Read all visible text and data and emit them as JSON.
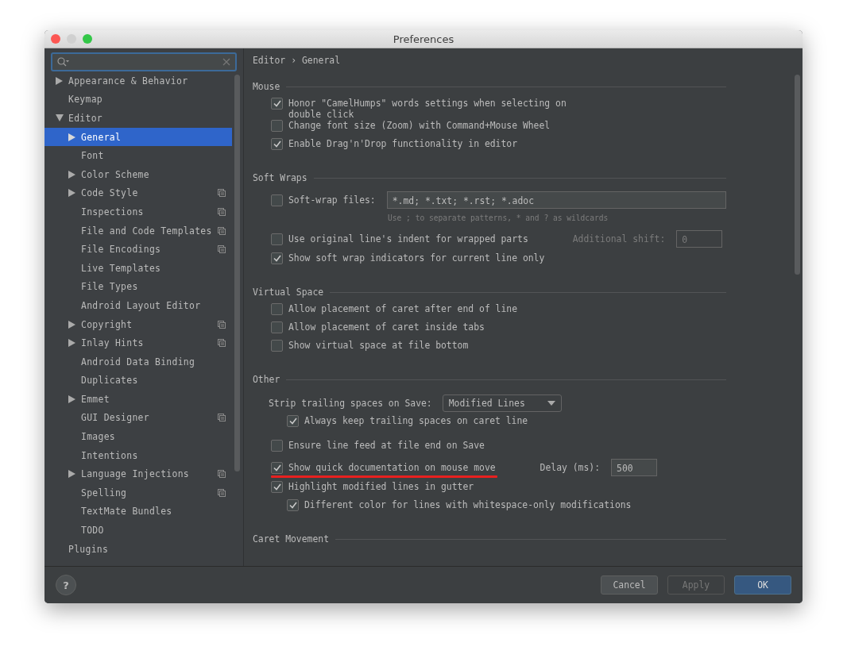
{
  "window": {
    "title": "Preferences"
  },
  "sidebar": {
    "items": [
      {
        "label": "Appearance & Behavior",
        "expanded": false,
        "selected": false,
        "project_scope": false
      },
      {
        "label": "Keymap",
        "selected": false,
        "project_scope": false
      },
      {
        "label": "Editor",
        "expanded": true,
        "selected": false,
        "project_scope": false,
        "children": [
          {
            "label": "General",
            "expanded": false,
            "selected": true,
            "project_scope": false
          },
          {
            "label": "Font",
            "selected": false,
            "project_scope": false
          },
          {
            "label": "Color Scheme",
            "expanded": false,
            "selected": false,
            "project_scope": false
          },
          {
            "label": "Code Style",
            "expanded": false,
            "selected": false,
            "project_scope": true
          },
          {
            "label": "Inspections",
            "selected": false,
            "project_scope": true
          },
          {
            "label": "File and Code Templates",
            "selected": false,
            "project_scope": true
          },
          {
            "label": "File Encodings",
            "selected": false,
            "project_scope": true
          },
          {
            "label": "Live Templates",
            "selected": false,
            "project_scope": false
          },
          {
            "label": "File Types",
            "selected": false,
            "project_scope": false
          },
          {
            "label": "Android Layout Editor",
            "selected": false,
            "project_scope": false
          },
          {
            "label": "Copyright",
            "expanded": false,
            "selected": false,
            "project_scope": true
          },
          {
            "label": "Inlay Hints",
            "expanded": false,
            "selected": false,
            "project_scope": true
          },
          {
            "label": "Android Data Binding",
            "selected": false,
            "project_scope": false
          },
          {
            "label": "Duplicates",
            "selected": false,
            "project_scope": false
          },
          {
            "label": "Emmet",
            "expanded": false,
            "selected": false,
            "project_scope": false
          },
          {
            "label": "GUI Designer",
            "selected": false,
            "project_scope": true
          },
          {
            "label": "Images",
            "selected": false,
            "project_scope": false
          },
          {
            "label": "Intentions",
            "selected": false,
            "project_scope": false
          },
          {
            "label": "Language Injections",
            "expanded": false,
            "selected": false,
            "project_scope": true
          },
          {
            "label": "Spelling",
            "selected": false,
            "project_scope": true
          },
          {
            "label": "TextMate Bundles",
            "selected": false,
            "project_scope": false
          },
          {
            "label": "TODO",
            "selected": false,
            "project_scope": false
          }
        ]
      },
      {
        "label": "Plugins",
        "selected": false,
        "project_scope": false
      }
    ]
  },
  "breadcrumb": [
    "Editor",
    "›",
    "General"
  ],
  "sections": [
    {
      "title": "Mouse",
      "items": [
        {
          "kind": "checkbox",
          "label": "Honor \"CamelHumps\" words settings when selecting on double click",
          "checked": true
        },
        {
          "kind": "checkbox",
          "label": "Change font size (Zoom) with Command+Mouse Wheel",
          "checked": false
        },
        {
          "kind": "checkbox",
          "label": "Enable Drag'n'Drop functionality in editor",
          "checked": true
        }
      ]
    },
    {
      "title": "Soft Wraps",
      "items": [
        {
          "kind": "checkbox_field",
          "label": "Soft-wrap files:",
          "checked": false,
          "value": "*.md; *.txt; *.rst; *.adoc",
          "hint": "Use ; to separate patterns, * and ? as wildcards"
        },
        {
          "kind": "checkbox",
          "label": "Use original line's indent for wrapped parts",
          "checked": false,
          "extra": {
            "label": "Additional shift:",
            "value": "0",
            "disabled": true
          }
        },
        {
          "kind": "checkbox",
          "label": "Show soft wrap indicators for current line only",
          "checked": true
        }
      ]
    },
    {
      "title": "Virtual Space",
      "items": [
        {
          "kind": "checkbox",
          "label": "Allow placement of caret after end of line",
          "checked": false
        },
        {
          "kind": "checkbox",
          "label": "Allow placement of caret inside tabs",
          "checked": false
        },
        {
          "kind": "checkbox",
          "label": "Show virtual space at file bottom",
          "checked": false
        }
      ]
    },
    {
      "title": "Other",
      "items": [
        {
          "kind": "dropdown",
          "label": "Strip trailing spaces on Save:",
          "value": "Modified Lines",
          "children": [
            {
              "kind": "checkbox",
              "label": "Always keep trailing spaces on caret line",
              "checked": true
            }
          ]
        },
        {
          "kind": "checkbox",
          "label": "Ensure line feed at file end on Save",
          "checked": false
        },
        {
          "kind": "checkbox",
          "label": "Show quick documentation on mouse move",
          "checked": true,
          "underlined": true,
          "extra": {
            "label": "Delay (ms):",
            "value": "500",
            "disabled": false
          }
        },
        {
          "kind": "checkbox",
          "label": "Highlight modified lines in gutter",
          "checked": true,
          "children": [
            {
              "kind": "checkbox",
              "label": "Different color for lines with whitespace-only modifications",
              "checked": true
            }
          ]
        }
      ]
    },
    {
      "title": "Caret Movement"
    }
  ],
  "help": "?",
  "buttons": [
    {
      "label": "Cancel",
      "default": false,
      "disabled": false
    },
    {
      "label": "Apply",
      "default": false,
      "disabled": true
    },
    {
      "label": "OK",
      "default": true,
      "disabled": false
    }
  ]
}
